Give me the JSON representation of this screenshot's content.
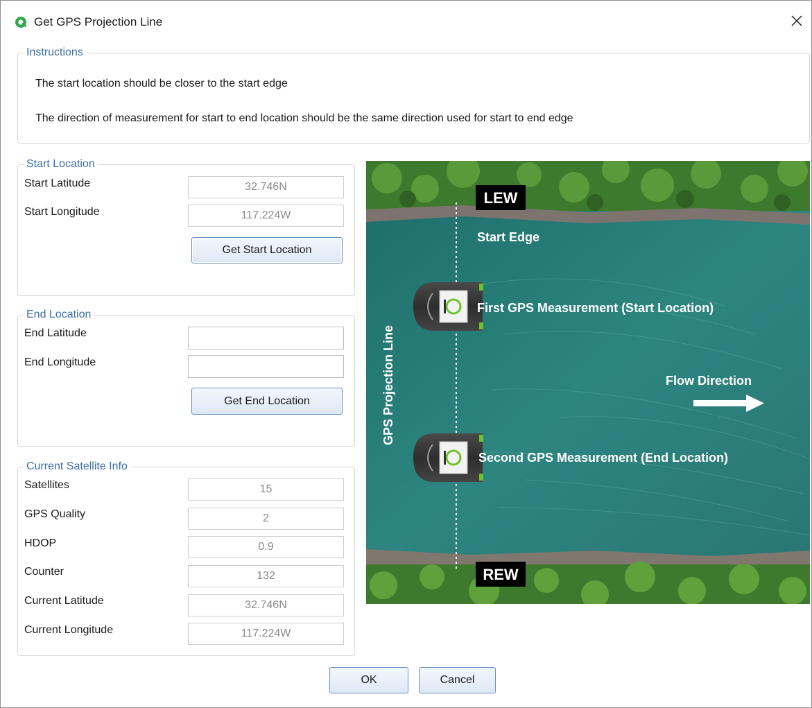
{
  "window": {
    "title": "Get GPS Projection Line"
  },
  "instructions": {
    "legend": "Instructions",
    "line1": "The start location should be closer to the start edge",
    "line2": "The direction of measurement for start to end location should be the same direction used for start to end edge"
  },
  "start_location": {
    "legend": "Start Location",
    "latitude_label": "Start Latitude",
    "latitude_value": "32.746N",
    "longitude_label": "Start Longitude",
    "longitude_value": "117.224W",
    "button_label": "Get Start Location"
  },
  "end_location": {
    "legend": "End Location",
    "latitude_label": "End Latitude",
    "latitude_value": "",
    "longitude_label": "End Longitude",
    "longitude_value": "",
    "button_label": "Get End Location"
  },
  "satellite_info": {
    "legend": "Current Satellite Info",
    "fields": [
      {
        "label": "Satellites",
        "value": "15"
      },
      {
        "label": "GPS Quality",
        "value": "2"
      },
      {
        "label": "HDOP",
        "value": "0.9"
      },
      {
        "label": "Counter",
        "value": "132"
      },
      {
        "label": "Current Latitude",
        "value": "32.746N"
      },
      {
        "label": "Current Longitude",
        "value": "117.224W"
      }
    ]
  },
  "diagram": {
    "lew_label": "LEW",
    "rew_label": "REW",
    "start_edge_label": "Start Edge",
    "projection_line_label": "GPS Projection Line",
    "first_measurement_label": "First GPS Measurement (Start Location)",
    "second_measurement_label": "Second GPS Measurement (End Location)",
    "flow_direction_label": "Flow Direction",
    "colors": {
      "water": "#2a7c78",
      "vegetation": "#3f7f2a",
      "bank": "#7a7068",
      "boat_hull": "#3a3a3a",
      "accent_green": "#6fc12c"
    }
  },
  "footer": {
    "ok_label": "OK",
    "cancel_label": "Cancel"
  },
  "icons": {
    "app": "app-logo-icon",
    "close": "close-icon",
    "boat": "boat-icon",
    "arrow": "arrow-right-icon"
  }
}
